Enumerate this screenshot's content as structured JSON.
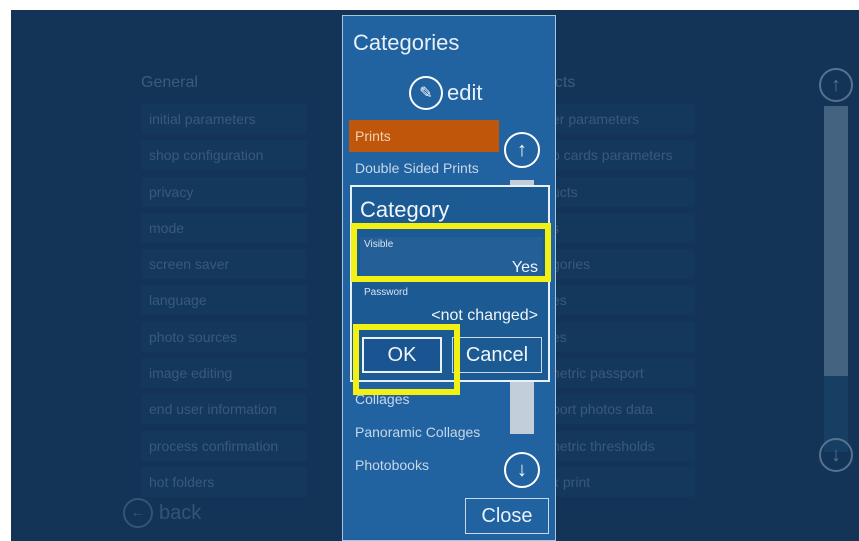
{
  "general": {
    "heading": "General",
    "items": [
      "initial parameters",
      "shop configuration",
      "privacy",
      "mode",
      "screen saver",
      "language",
      "photo sources",
      "image editing",
      "end user information",
      "process confirmation",
      "hot folders"
    ]
  },
  "products": {
    "heading": "ucts",
    "items": [
      "er parameters",
      "o cards parameters",
      "ucts",
      "s",
      "gories",
      "es",
      "es",
      "netric passport",
      "port photos data",
      "netric thresholds",
      "x print"
    ]
  },
  "back_label": "back",
  "categories_panel": {
    "title": "Categories",
    "edit_label": "edit",
    "items": [
      "Prints",
      "Double Sided Prints",
      "",
      "",
      "",
      "",
      "",
      "",
      "Collages",
      "Panoramic Collages",
      "Photobooks"
    ],
    "close_label": "Close"
  },
  "dialog": {
    "title": "Category",
    "visible_label": "Visible",
    "visible_value": "Yes",
    "password_label": "Password",
    "password_value": "<not changed>",
    "ok_label": "OK",
    "cancel_label": "Cancel"
  },
  "icons": {
    "up": "arrow-up-icon",
    "down": "arrow-down-icon",
    "edit": "pencil-icon",
    "back": "arrow-left-icon"
  },
  "colors": {
    "background": "#133456",
    "panel": "#2162a0",
    "selected": "#c0560a",
    "highlight": "#f3f014"
  }
}
